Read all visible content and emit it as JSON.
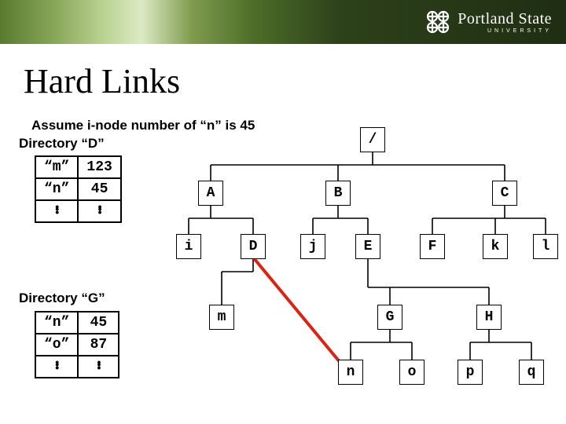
{
  "banner": {
    "brand_main": "Portland State",
    "brand_sub": "UNIVERSITY"
  },
  "title": "Hard Links",
  "assume_text": "Assume i-node number of “n” is 45",
  "dir_d": {
    "label": "Directory “D”",
    "rows": [
      {
        "name": "“m”",
        "inode": "123"
      },
      {
        "name": "“n”",
        "inode": "45"
      }
    ]
  },
  "dir_g": {
    "label": "Directory “G”",
    "rows": [
      {
        "name": "“n”",
        "inode": "45"
      },
      {
        "name": "“o”",
        "inode": "87"
      }
    ]
  },
  "tree_nodes": {
    "root": "/",
    "A": "A",
    "B": "B",
    "C": "C",
    "i": "i",
    "D": "D",
    "j": "j",
    "E": "E",
    "F": "F",
    "k": "k",
    "l": "l",
    "m": "m",
    "G": "G",
    "H": "H",
    "n": "n",
    "o": "o",
    "p": "p",
    "q": "q"
  },
  "chart_data": {
    "type": "tree",
    "title": "Filesystem directory tree with hard link",
    "nodes": [
      "/",
      "A",
      "B",
      "C",
      "i",
      "D",
      "j",
      "E",
      "F",
      "k",
      "l",
      "m",
      "G",
      "H",
      "n",
      "o",
      "p",
      "q"
    ],
    "edges": [
      [
        "/",
        "A"
      ],
      [
        "/",
        "B"
      ],
      [
        "/",
        "C"
      ],
      [
        "A",
        "i"
      ],
      [
        "A",
        "D"
      ],
      [
        "B",
        "j"
      ],
      [
        "B",
        "E"
      ],
      [
        "C",
        "F"
      ],
      [
        "C",
        "k"
      ],
      [
        "C",
        "l"
      ],
      [
        "D",
        "m"
      ],
      [
        "E",
        "G"
      ],
      [
        "E",
        "H"
      ],
      [
        "G",
        "n"
      ],
      [
        "G",
        "o"
      ],
      [
        "H",
        "p"
      ],
      [
        "H",
        "q"
      ]
    ],
    "hard_link_edges": [
      [
        "D",
        "n"
      ]
    ],
    "inode_tables": {
      "D": [
        [
          "m",
          123
        ],
        [
          "n",
          45
        ]
      ],
      "G": [
        [
          "n",
          45
        ],
        [
          "o",
          87
        ]
      ]
    }
  }
}
